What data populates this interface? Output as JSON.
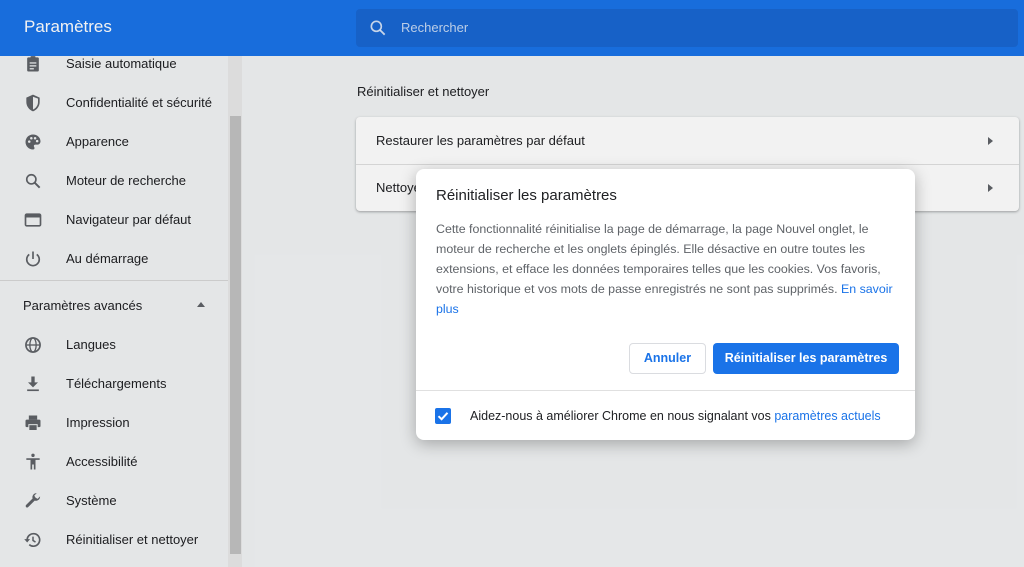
{
  "header": {
    "title": "Paramètres",
    "search_placeholder": "Rechercher",
    "accent_color": "#1a73e8"
  },
  "sidebar": {
    "items": [
      {
        "label": "Saisie automatique",
        "icon": "assignment-icon"
      },
      {
        "label": "Confidentialité et sécurité",
        "icon": "shield-icon"
      },
      {
        "label": "Apparence",
        "icon": "palette-icon"
      },
      {
        "label": "Moteur de recherche",
        "icon": "search-icon"
      },
      {
        "label": "Navigateur par défaut",
        "icon": "browser-icon"
      },
      {
        "label": "Au démarrage",
        "icon": "power-icon"
      }
    ],
    "advanced_label": "Paramètres avancés",
    "advanced_items": [
      {
        "label": "Langues",
        "icon": "globe-icon"
      },
      {
        "label": "Téléchargements",
        "icon": "download-icon"
      },
      {
        "label": "Impression",
        "icon": "printer-icon"
      },
      {
        "label": "Accessibilité",
        "icon": "accessibility-icon"
      },
      {
        "label": "Système",
        "icon": "wrench-icon"
      },
      {
        "label": "Réinitialiser et nettoyer",
        "icon": "history-icon"
      }
    ]
  },
  "main": {
    "section_title": "Réinitialiser et nettoyer",
    "rows": [
      {
        "label": "Restaurer les paramètres par défaut"
      },
      {
        "label": "Nettoyer l'ordinateur"
      }
    ]
  },
  "dialog": {
    "title": "Réinitialiser les paramètres",
    "body": "Cette fonctionnalité réinitialise la page de démarrage, la page Nouvel onglet, le moteur de recherche et les onglets épinglés. Elle désactive en outre toutes les extensions, et efface les données temporaires telles que les cookies. Vos favoris, votre historique et vos mots de passe enregistrés ne sont pas supprimés.",
    "learn_more": "En savoir plus",
    "cancel_label": "Annuler",
    "reset_label": "Réinitialiser les paramètres",
    "footer_text": "Aidez-nous à améliorer Chrome en nous signalant vos",
    "footer_link": "paramètres actuels",
    "checkbox_checked": true
  }
}
